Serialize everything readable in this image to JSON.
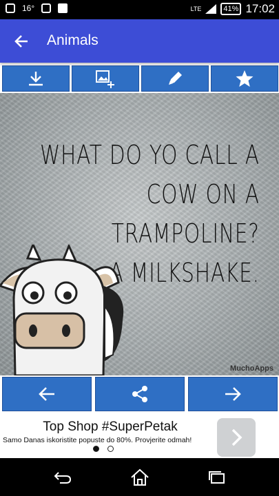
{
  "status_bar": {
    "temperature": "16°",
    "network": "LTE",
    "battery": "41%",
    "time": "17:02"
  },
  "app_bar": {
    "title": "Animals",
    "back_icon": "arrow-left-icon"
  },
  "toolbar": {
    "buttons": [
      {
        "icon": "download-icon"
      },
      {
        "icon": "add-image-icon"
      },
      {
        "icon": "pencil-icon"
      },
      {
        "icon": "star-icon"
      }
    ],
    "color": "#2f6fc4"
  },
  "meme": {
    "lines": [
      "WHAT DO YO CALL A",
      "COW ON A",
      "TRAMPOLINE?",
      "A MILKSHAKE."
    ],
    "watermark": "MuchoApps"
  },
  "nav_buttons": [
    {
      "icon": "arrow-left-icon"
    },
    {
      "icon": "share-icon"
    },
    {
      "icon": "arrow-right-icon"
    }
  ],
  "ad": {
    "headline": "Top Shop #SuperPetak",
    "body": "Samo Danas iskoristite popuste do 80%. Provjerite odmah!"
  },
  "colors": {
    "app_bar": "#3d4dd6",
    "button": "#2f6fc4"
  }
}
